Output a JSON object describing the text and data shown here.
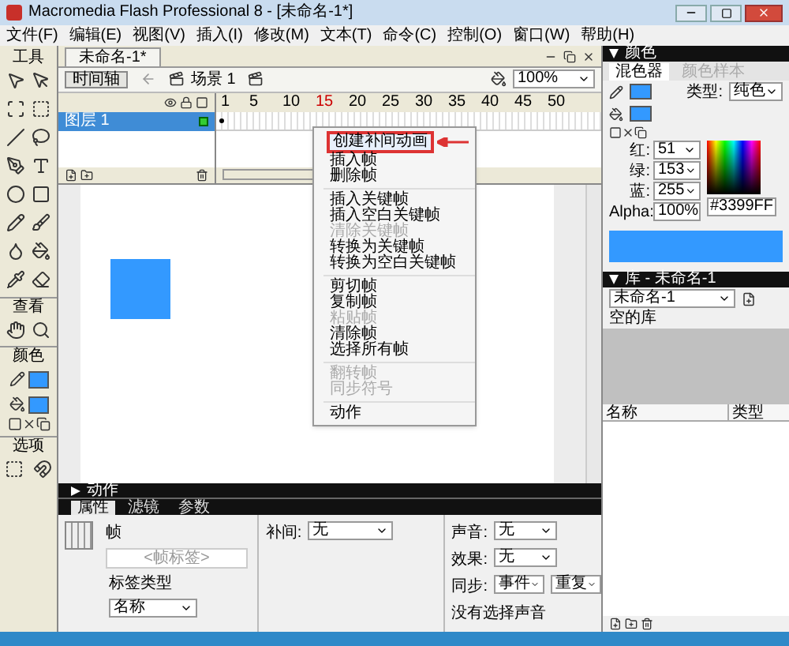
{
  "window": {
    "title": "Macromedia Flash Professional 8 - [未命名-1*]"
  },
  "menu_bar": [
    "文件(F)",
    "编辑(E)",
    "视图(V)",
    "插入(I)",
    "修改(M)",
    "文本(T)",
    "命令(C)",
    "控制(O)",
    "窗口(W)",
    "帮助(H)"
  ],
  "tools_panel": {
    "title": "工具",
    "view_title": "查看",
    "color_title": "颜色",
    "options_title": "选项"
  },
  "document_tab": {
    "label": "未命名-1*"
  },
  "edit_bar": {
    "timeline_button": "时间轴",
    "scene": "场景 1",
    "zoom": "100%"
  },
  "timeline": {
    "ruler": [
      {
        "label": "1",
        "current": false
      },
      {
        "label": "5",
        "current": false
      },
      {
        "label": "10",
        "current": false
      },
      {
        "label": "15",
        "current": true
      },
      {
        "label": "20",
        "current": false
      },
      {
        "label": "25",
        "current": false
      },
      {
        "label": "30",
        "current": false
      },
      {
        "label": "35",
        "current": false
      },
      {
        "label": "40",
        "current": false
      },
      {
        "label": "45",
        "current": false
      },
      {
        "label": "50",
        "current": false
      }
    ],
    "layers": [
      {
        "name": "图层 1",
        "selected": true
      }
    ]
  },
  "context_menu": {
    "items": [
      {
        "kind": "item",
        "label": "创建补间动画",
        "disabled": false,
        "highlighted": true
      },
      {
        "kind": "item",
        "label": "插入帧",
        "disabled": false,
        "highlighted": false
      },
      {
        "kind": "item",
        "label": "删除帧",
        "disabled": false,
        "highlighted": false
      },
      {
        "kind": "separator"
      },
      {
        "kind": "item",
        "label": "插入关键帧",
        "disabled": false,
        "highlighted": false
      },
      {
        "kind": "item",
        "label": "插入空白关键帧",
        "disabled": false,
        "highlighted": false
      },
      {
        "kind": "item",
        "label": "清除关键帧",
        "disabled": true,
        "highlighted": false
      },
      {
        "kind": "item",
        "label": "转换为关键帧",
        "disabled": false,
        "highlighted": false
      },
      {
        "kind": "item",
        "label": "转换为空白关键帧",
        "disabled": false,
        "highlighted": false
      },
      {
        "kind": "separator"
      },
      {
        "kind": "item",
        "label": "剪切帧",
        "disabled": false,
        "highlighted": false
      },
      {
        "kind": "item",
        "label": "复制帧",
        "disabled": false,
        "highlighted": false
      },
      {
        "kind": "item",
        "label": "粘贴帧",
        "disabled": true,
        "highlighted": false
      },
      {
        "kind": "item",
        "label": "清除帧",
        "disabled": false,
        "highlighted": false
      },
      {
        "kind": "item",
        "label": "选择所有帧",
        "disabled": false,
        "highlighted": false
      },
      {
        "kind": "separator"
      },
      {
        "kind": "item",
        "label": "翻转帧",
        "disabled": true,
        "highlighted": false
      },
      {
        "kind": "item",
        "label": "同步符号",
        "disabled": true,
        "highlighted": false
      },
      {
        "kind": "separator"
      },
      {
        "kind": "item",
        "label": "动作",
        "disabled": false,
        "highlighted": false
      }
    ]
  },
  "actions_panel": {
    "title": "动作",
    "expanded": false
  },
  "properties_panel": {
    "tabs": [
      {
        "label": "属性",
        "selected": true
      },
      {
        "label": "滤镜",
        "selected": false
      },
      {
        "label": "参数",
        "selected": false
      }
    ],
    "frame_title": "帧",
    "frame_label_placeholder": "<帧标签>",
    "label_type_title": "标签类型",
    "label_type_value": "名称",
    "tween_label": "补间:",
    "tween_value": "无",
    "sound_label": "声音:",
    "sound_value": "无",
    "effect_label": "效果:",
    "effect_value": "无",
    "sync_label": "同步:",
    "sync_value": "事件",
    "repeat_value": "重复",
    "sound_status": "没有选择声音"
  },
  "color_panel": {
    "title": "颜色",
    "expanded": true,
    "tabs": [
      {
        "label": "混色器",
        "selected": true
      },
      {
        "label": "颜色样本",
        "selected": false
      }
    ],
    "type_label": "类型:",
    "type_value": "纯色",
    "channels": [
      {
        "label": "红:",
        "value": "51"
      },
      {
        "label": "绿:",
        "value": "153"
      },
      {
        "label": "蓝:",
        "value": "255"
      },
      {
        "label": "Alpha:",
        "value": "100%"
      }
    ],
    "hex": "#3399FF"
  },
  "library_panel": {
    "title": "库 - 未命名-1",
    "expanded": true,
    "document": "未命名-1",
    "status": "空的库",
    "columns": [
      "名称",
      "类型"
    ]
  }
}
